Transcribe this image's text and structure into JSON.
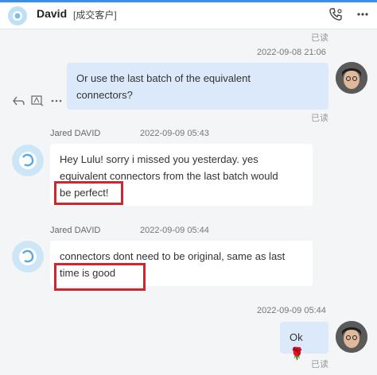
{
  "header": {
    "name": "David",
    "tag": "[成交客户]",
    "icons": [
      "phone-settings-icon",
      "more-icon"
    ]
  },
  "messages": [
    {
      "read_status": "已读"
    },
    {
      "timestamp": "2022-09-08 21:06",
      "text_line1": "Or use the last batch of the equivalent",
      "text_line2": "connectors?",
      "read_status": "已读",
      "actions": [
        "reply-icon",
        "translate-icon",
        "more-icon"
      ]
    },
    {
      "sender": "Jared DAVID",
      "timestamp": "2022-09-09 05:43",
      "text_line1": "Hey Lulu! sorry i missed you yesterday. yes",
      "text_line2": "equivalent connectors from the last batch would",
      "text_line3": "be perfect!"
    },
    {
      "sender": "Jared DAVID",
      "timestamp": "2022-09-09 05:44",
      "text_line1": "connectors dont need to be original, same as last",
      "text_line2": "time is good"
    },
    {
      "timestamp": "2022-09-09 05:44",
      "text": "Ok",
      "emoji": "🌹",
      "read_status": "已读"
    }
  ],
  "colors": {
    "accent": "#3a8ee6",
    "highlight": "#d0262e",
    "outgoing_bubble": "#dbe9fb"
  }
}
